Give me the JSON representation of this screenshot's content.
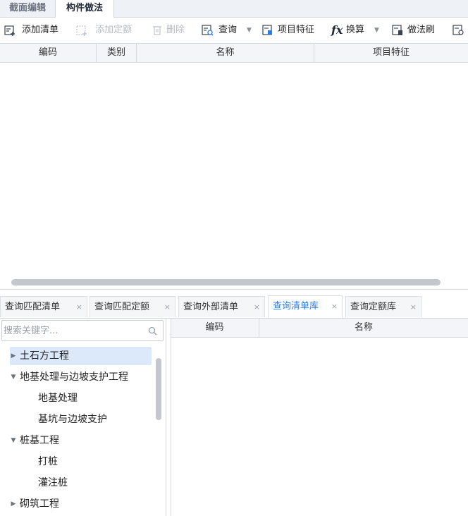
{
  "top_tabs": [
    {
      "label": "截面编辑",
      "active": false
    },
    {
      "label": "构件做法",
      "active": true
    }
  ],
  "toolbar": {
    "add_list": "添加清单",
    "add_quota": "添加定额",
    "delete": "删除",
    "query": "查询",
    "item_features": "项目特征",
    "convert_icon_text": "fx",
    "convert": "换算",
    "method_brush": "做法刷"
  },
  "upper_grid": {
    "columns": [
      "编码",
      "类别",
      "名称",
      "项目特征"
    ]
  },
  "bottom_tabs": [
    {
      "label": "查询匹配清单",
      "active": false
    },
    {
      "label": "查询匹配定额",
      "active": false
    },
    {
      "label": "查询外部清单",
      "active": false
    },
    {
      "label": "查询清单库",
      "active": true
    },
    {
      "label": "查询定额库",
      "active": false
    }
  ],
  "close_glyph": "×",
  "search": {
    "placeholder": "搜索关键字..."
  },
  "tree": [
    {
      "label": "土石方工程",
      "level": 0,
      "state": "collapsed",
      "selected": true
    },
    {
      "label": "地基处理与边坡支护工程",
      "level": 0,
      "state": "expanded",
      "selected": false
    },
    {
      "label": "地基处理",
      "level": 1,
      "state": "leaf",
      "selected": false
    },
    {
      "label": "基坑与边坡支护",
      "level": 1,
      "state": "leaf",
      "selected": false
    },
    {
      "label": "桩基工程",
      "level": 0,
      "state": "expanded",
      "selected": false
    },
    {
      "label": "打桩",
      "level": 1,
      "state": "leaf",
      "selected": false
    },
    {
      "label": "灌注桩",
      "level": 1,
      "state": "leaf",
      "selected": false
    },
    {
      "label": "砌筑工程",
      "level": 0,
      "state": "collapsed",
      "selected": false
    }
  ],
  "lower_grid": {
    "columns": [
      "编码",
      "名称"
    ]
  },
  "colors": {
    "accent": "#2b7de9",
    "selection": "#dce9fb",
    "border": "#d4d8de"
  }
}
